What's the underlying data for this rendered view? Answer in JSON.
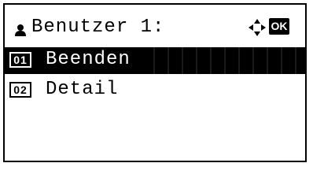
{
  "header": {
    "title": "Benutzer 1:",
    "user_icon": "user-icon",
    "nav_icon": "four-way-arrow-icon",
    "ok_label": "OK"
  },
  "menu": {
    "items": [
      {
        "number": "01",
        "label": "Beenden",
        "selected": true
      },
      {
        "number": "02",
        "label": "Detail",
        "selected": false
      }
    ]
  },
  "colors": {
    "background": "#ffffff",
    "foreground": "#000000",
    "highlight": "#000000"
  }
}
